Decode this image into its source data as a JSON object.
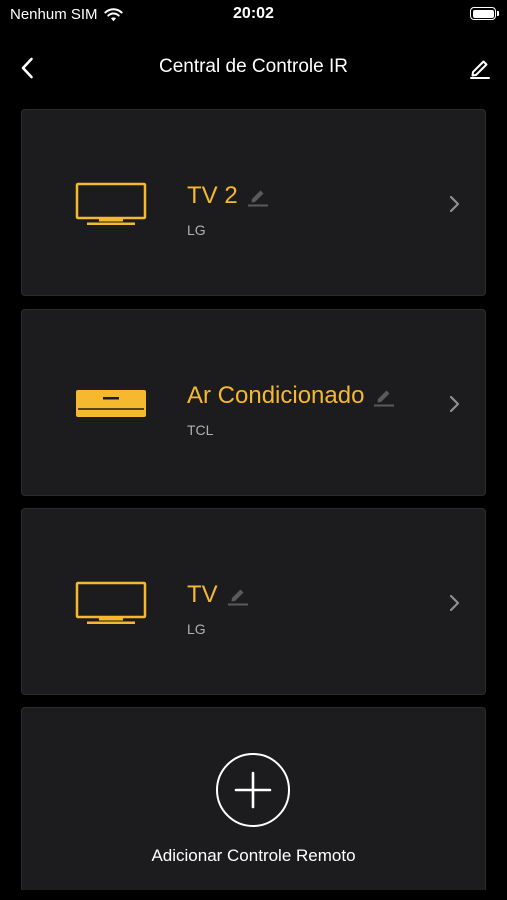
{
  "status_bar": {
    "carrier": "Nenhum SIM",
    "time": "20:02",
    "wifi_icon": "wifi-icon",
    "battery_icon": "battery-icon"
  },
  "nav": {
    "title": "Central de Controle IR",
    "back_icon": "chevron-left-icon",
    "edit_icon": "pencil-icon"
  },
  "devices": [
    {
      "name": "TV 2",
      "brand": "LG",
      "icon": "tv-icon"
    },
    {
      "name": "Ar Condicionado",
      "brand": "TCL",
      "icon": "air-conditioner-icon"
    },
    {
      "name": "TV",
      "brand": "LG",
      "icon": "tv-icon"
    }
  ],
  "add_remote": {
    "label": "Adicionar Controle Remoto",
    "icon": "plus-icon"
  },
  "colors": {
    "background": "#000000",
    "card": "#1c1c1e",
    "accent": "#f5b82e",
    "text": "#ffffff",
    "secondary_text": "#b0b0b0"
  }
}
